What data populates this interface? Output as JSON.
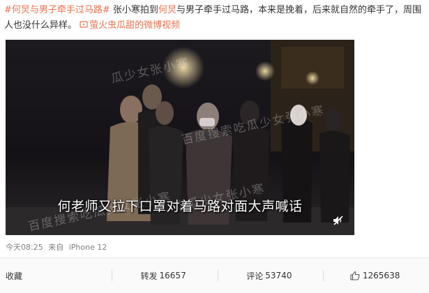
{
  "post": {
    "hashtag": "#何炅与男子牵手过马路#",
    "text_before": " 张小寒拍到",
    "mention": "何炅",
    "text_after": "与男子牵手过马路，本来是挽着，后来就自然的牵手了，周围人也没什么异样。",
    "video_link": "萤火虫瓜甜的微博视频"
  },
  "video": {
    "subtitle": "何老师又拉下口罩对着马路对面大声喊话",
    "watermarks": [
      "瓜少女张小寒",
      "百度搜索吃瓜少女张小寒",
      "百度搜索吃瓜少女张小寒",
      "吃瓜少女张小寒"
    ],
    "mute_icon": "volume-muted-icon"
  },
  "meta": {
    "time": "今天08:25",
    "source_prefix": "来自",
    "source": "iPhone 12"
  },
  "actions": {
    "favorite": "收藏",
    "repost_label": "转发",
    "repost_count": "16657",
    "comment_label": "评论",
    "comment_count": "53740",
    "like_count": "1265638",
    "like_icon": "thumbs-up-icon"
  },
  "colors": {
    "link": "#eb7350",
    "text": "#333333",
    "meta": "#808080"
  }
}
